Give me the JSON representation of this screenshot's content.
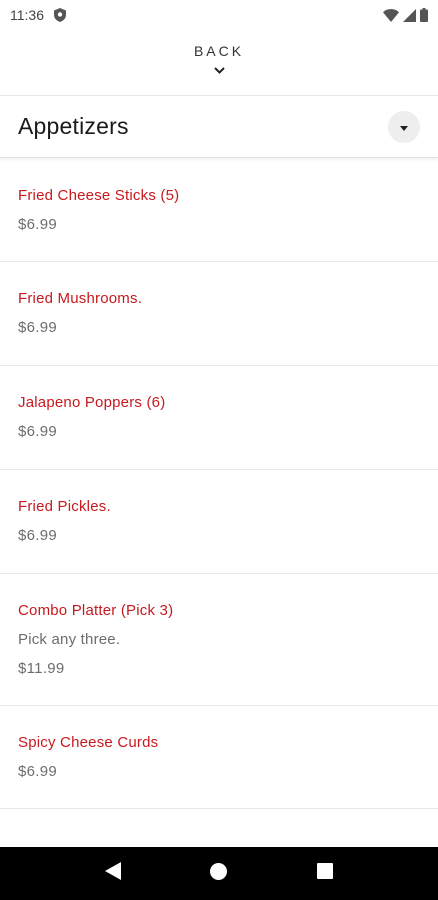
{
  "status_bar": {
    "time": "11:36",
    "icons": [
      "shield-icon",
      "wifi-icon",
      "signal-icon",
      "battery-icon"
    ]
  },
  "header": {
    "back_label": "BACK",
    "back_icon": "chevron-down-icon"
  },
  "category": {
    "title": "Appetizers",
    "toggle_icon": "caret-down-icon"
  },
  "menu_items": [
    {
      "name": "Fried Cheese Sticks (5)",
      "description": "",
      "price": "$6.99"
    },
    {
      "name": "Fried Mushrooms.",
      "description": "",
      "price": "$6.99"
    },
    {
      "name": "Jalapeno Poppers (6)",
      "description": "",
      "price": "$6.99"
    },
    {
      "name": "Fried Pickles.",
      "description": "",
      "price": "$6.99"
    },
    {
      "name": "Combo Platter (Pick 3)",
      "description": "Pick any three.",
      "price": "$11.99"
    },
    {
      "name": "Spicy Cheese Curds",
      "description": "",
      "price": "$6.99"
    }
  ],
  "nav_bar": {
    "buttons": [
      "back-triangle-icon",
      "home-circle-icon",
      "recents-square-icon"
    ]
  },
  "colors": {
    "item_name": "#c8191e",
    "price": "#6d6d6d",
    "nav_bg": "#000000"
  }
}
